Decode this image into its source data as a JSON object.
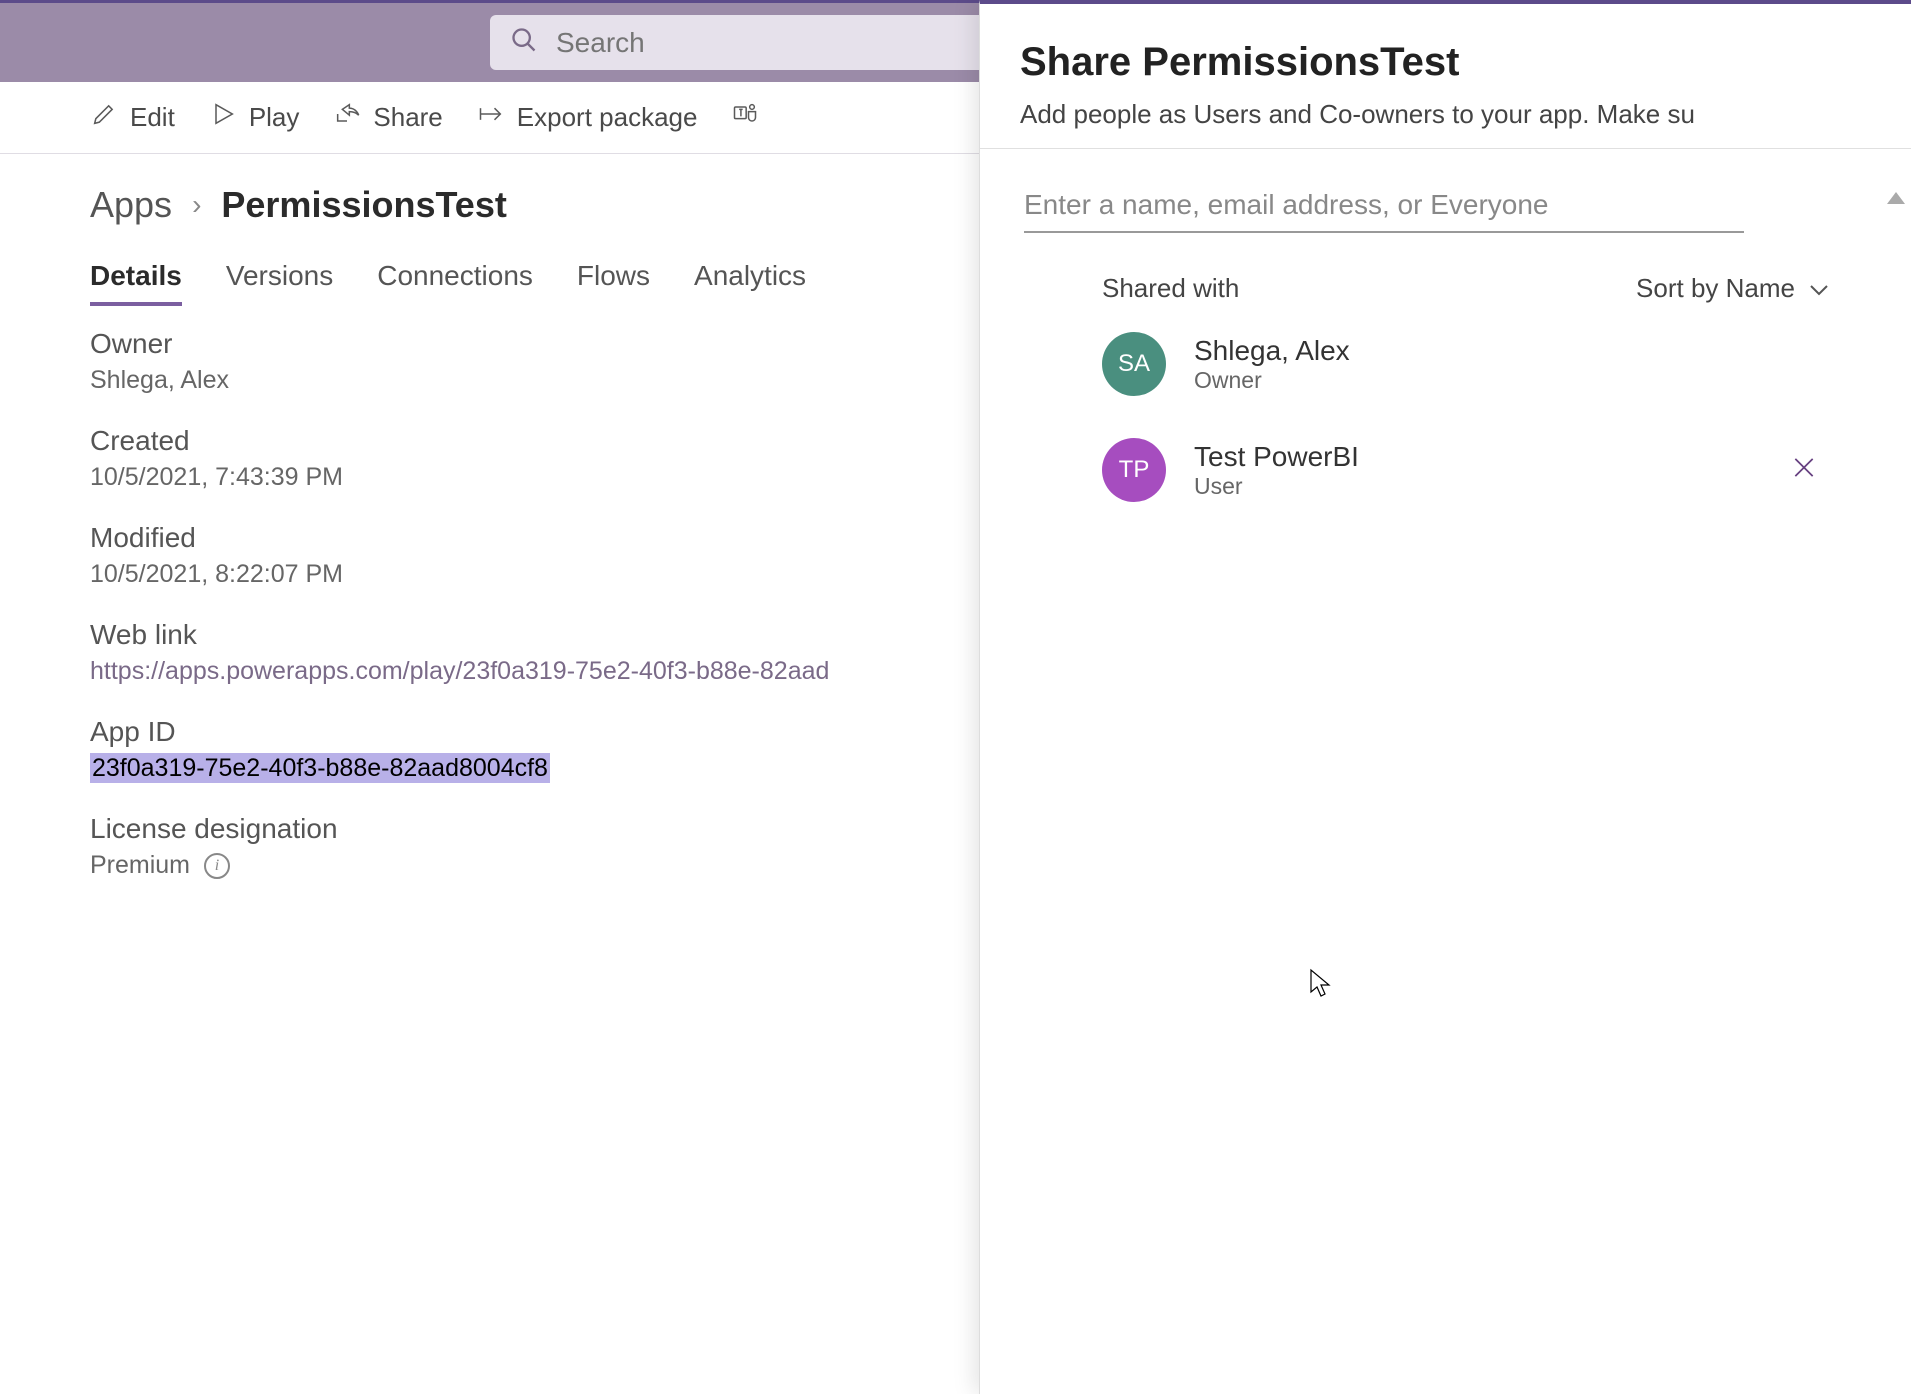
{
  "header": {
    "search_placeholder": "Search"
  },
  "commands": {
    "edit": "Edit",
    "play": "Play",
    "share": "Share",
    "export": "Export package",
    "teams": ""
  },
  "breadcrumb": {
    "root": "Apps",
    "current": "PermissionsTest"
  },
  "tabs": [
    "Details",
    "Versions",
    "Connections",
    "Flows",
    "Analytics"
  ],
  "active_tab": "Details",
  "details": {
    "owner_label": "Owner",
    "owner_value": "Shlega, Alex",
    "created_label": "Created",
    "created_value": "10/5/2021, 7:43:39 PM",
    "modified_label": "Modified",
    "modified_value": "10/5/2021, 8:22:07 PM",
    "weblink_label": "Web link",
    "weblink_value": "https://apps.powerapps.com/play/23f0a319-75e2-40f3-b88e-82aad",
    "appid_label": "App ID",
    "appid_value": "23f0a319-75e2-40f3-b88e-82aad8004cf8",
    "license_label": "License designation",
    "license_value": "Premium"
  },
  "panel": {
    "title": "Share PermissionsTest",
    "subtitle": "Add people as Users and Co-owners to your app. Make su",
    "people_placeholder": "Enter a name, email address, or Everyone",
    "shared_with": "Shared with",
    "sort_by": "Sort by Name",
    "users": [
      {
        "initials": "SA",
        "name": "Shlega, Alex",
        "role": "Owner",
        "avatar_color": "teal",
        "removable": false
      },
      {
        "initials": "TP",
        "name": "Test PowerBI",
        "role": "User",
        "avatar_color": "purple",
        "removable": true
      }
    ]
  }
}
